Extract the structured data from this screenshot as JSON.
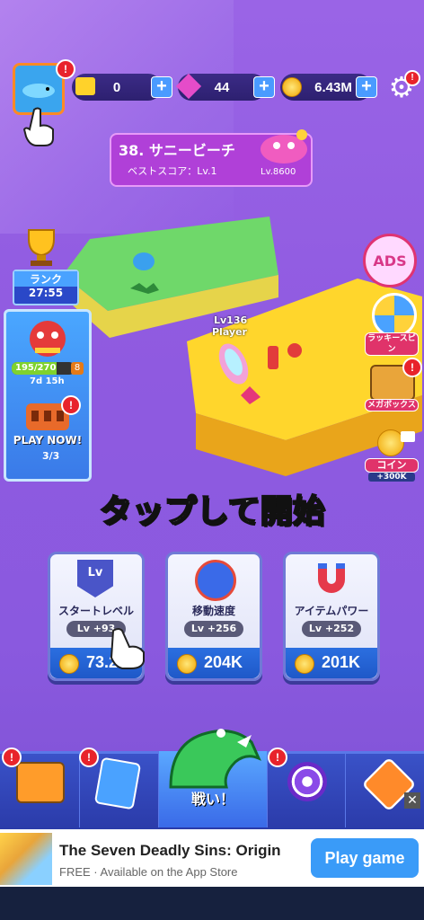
{
  "resources": {
    "tickets": "0",
    "gems": "44",
    "coins": "6.43M"
  },
  "stage": {
    "title": "38. サニービーチ",
    "best_score": "ベストスコア：Lv.1",
    "boss_level": "Lv.8600"
  },
  "rank": {
    "label": "ランク",
    "timer": "27:55"
  },
  "event": {
    "progress": "195/270",
    "level": "8",
    "timer": "7d 15h",
    "play_now": "PLAY NOW!",
    "count": "3/3"
  },
  "player": {
    "level": "Lv136",
    "name": "Player"
  },
  "side_menu": {
    "ads": "ADS",
    "lucky_spin": "ラッキースピン",
    "mega_box": "メガボックス",
    "coin": "コイン",
    "coin_bonus": "+300K"
  },
  "tap_to_start": "タップして開始",
  "upgrades": [
    {
      "label": "スタートレベル",
      "level": "Lv +93",
      "price": "73.2"
    },
    {
      "label": "移動速度",
      "level": "Lv +256",
      "price": "204K"
    },
    {
      "label": "アイテムパワー",
      "level": "Lv +252",
      "price": "201K"
    }
  ],
  "nav": {
    "fight": "戦い！"
  },
  "badges": {
    "alert": "!"
  },
  "ad": {
    "title": "The Seven Deadly Sins: Origin",
    "subtitle": "FREE · Available on the App Store",
    "cta": "Play game"
  },
  "colors": {
    "background": "#9a64e6",
    "accent_blue": "#2b6fe0",
    "badge_red": "#e8232b",
    "nav_bar": "#3048b8"
  }
}
